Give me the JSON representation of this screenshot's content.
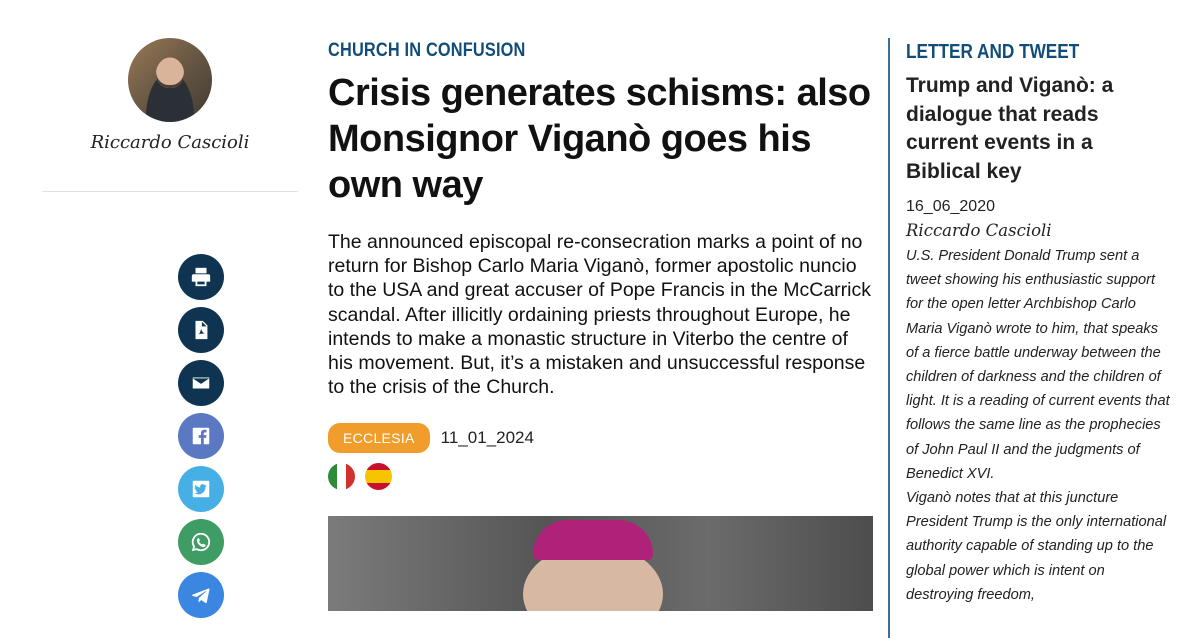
{
  "author": {
    "name": "Riccardo Cascioli"
  },
  "share": [
    {
      "name": "print-button",
      "icon": "print-icon"
    },
    {
      "name": "pdf-button",
      "icon": "pdf-icon"
    },
    {
      "name": "email-button",
      "icon": "email-icon"
    },
    {
      "name": "facebook-button",
      "icon": "facebook-icon"
    },
    {
      "name": "twitter-button",
      "icon": "twitter-icon"
    },
    {
      "name": "whatsapp-button",
      "icon": "whatsapp-icon"
    },
    {
      "name": "telegram-button",
      "icon": "telegram-icon"
    }
  ],
  "article": {
    "kicker": "CHURCH IN CONFUSION",
    "headline": "Crisis generates schisms: also Monsignor Viganò goes his own way",
    "lead": "The announced episcopal re-consecration marks a point of no return for Bishop Carlo Maria Viganò, former apostolic nuncio to the USA and great accuser of Pope Francis in the McCarrick scandal. After illicitly ordaining priests throughout Europe, he intends to make a monastic structure in Viterbo the centre of his movement. But, it’s a mistaken and unsuccessful response to the crisis of the Church.",
    "tag": "ECCLESIA",
    "date": "11_01_2024",
    "flags": [
      "italian-flag-icon",
      "spanish-flag-icon"
    ]
  },
  "sidebar": {
    "kicker": "LETTER AND TWEET",
    "title": "Trump and Viganò: a dialogue that reads current events in a Biblical key",
    "date": "16_06_2020",
    "author": "Riccardo Cascioli",
    "excerpt_1": "U.S. President Donald Trump sent a tweet showing his enthusiastic support for the open letter Archbishop Carlo Maria Viganò wrote to him, that speaks of a fierce battle underway between the children of darkness and the children of light. It is a reading of current events that follows the same line as the prophecies of John Paul II and the judgments of Benedict XVI.",
    "excerpt_2": "Viganò notes that at this juncture President Trump is the only international authority capable of standing up to the global power which is intent on destroying freedom,"
  },
  "colors": {
    "kicker": "#124d7a",
    "tag": "#f19d2c",
    "share_dark": "#0f3452",
    "facebook": "#5b79c3",
    "twitter": "#45afe6",
    "whatsapp": "#3f9c65",
    "telegram": "#3a86e0",
    "sidebar_rule": "#3b6e9a"
  }
}
